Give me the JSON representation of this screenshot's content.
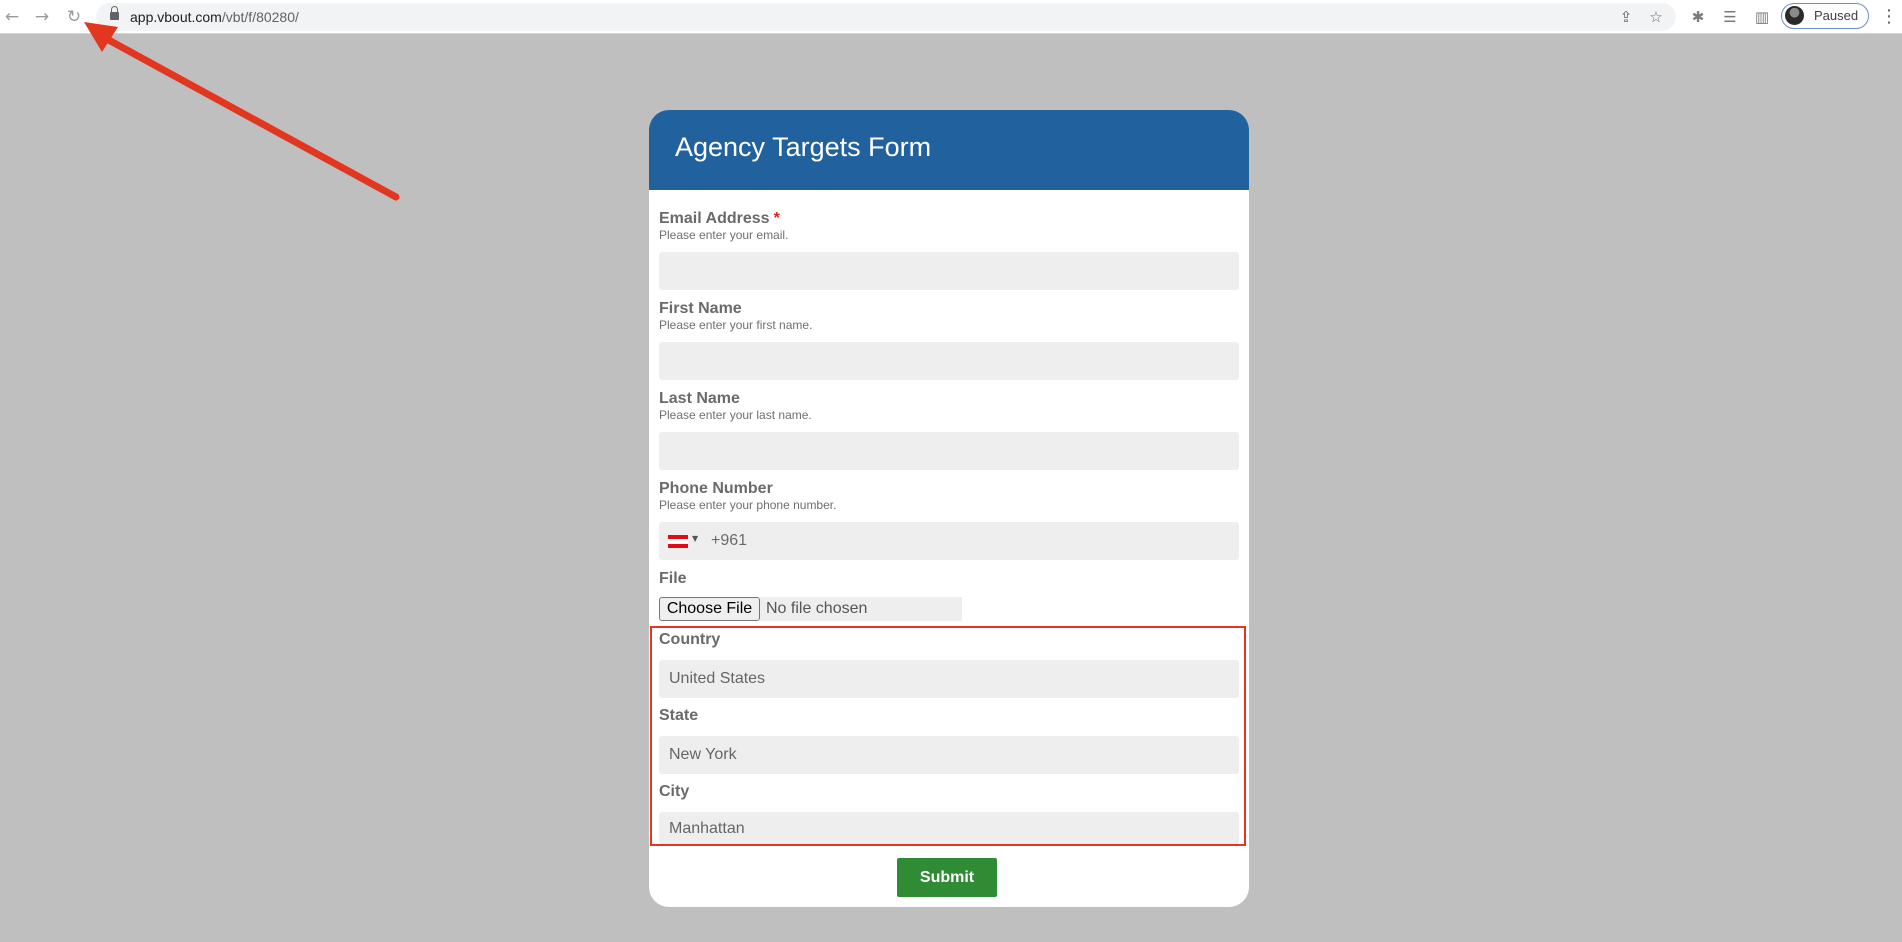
{
  "browser": {
    "url_host": "app.vbout.com",
    "url_path": "/vbt/f/80280/",
    "profile_label": "Paused"
  },
  "form": {
    "title": "Agency Targets Form",
    "fields": {
      "email": {
        "label": "Email Address",
        "required_mark": "*",
        "hint": "Please enter your email.",
        "value": ""
      },
      "first_name": {
        "label": "First Name",
        "hint": "Please enter your first name.",
        "value": ""
      },
      "last_name": {
        "label": "Last Name",
        "hint": "Please enter your last name.",
        "value": ""
      },
      "phone": {
        "label": "Phone Number",
        "hint": "Please enter your phone number.",
        "dial_code": "+961",
        "flag_colors": [
          "#e30a17",
          "#ffffff",
          "#e30a17"
        ]
      },
      "file": {
        "label": "File",
        "button_label": "Choose File",
        "status": "No file chosen"
      },
      "country": {
        "label": "Country",
        "value": "United States"
      },
      "state": {
        "label": "State",
        "value": "New York"
      },
      "city": {
        "label": "City",
        "value": "Manhattan"
      }
    },
    "submit_label": "Submit"
  },
  "colors": {
    "header": "#20619e",
    "submit": "#2f8c35",
    "annotation": "#e2361f",
    "required": "#e0211d"
  }
}
